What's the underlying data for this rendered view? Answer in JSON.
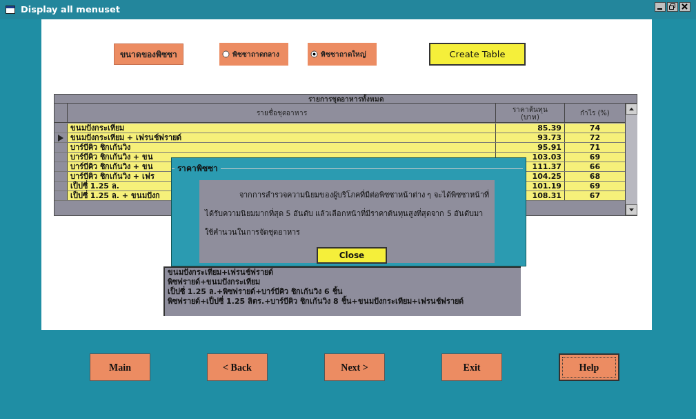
{
  "window": {
    "title": "Display all menuset"
  },
  "size_label": "ขนาดของพิซซา",
  "size_options": [
    {
      "label": "พิซซาถาดกลาง",
      "selected": false
    },
    {
      "label": "พิซซาถาดใหญ่",
      "selected": true
    }
  ],
  "create_button": "Create Table",
  "grid": {
    "title": "รายการชุดอาหารทั้งหมด",
    "columns": [
      "รายชื่อชุดอาหาร",
      "ราคาต้นทุน (บาท)",
      "กำไร (%)"
    ],
    "rows": [
      {
        "name": "ขนมปังกระเทียม",
        "cost": "85.39",
        "profit": "74",
        "current": false
      },
      {
        "name": "ขนมปังกระเทียม + เฟรนช์ฟรายด์",
        "cost": "93.73",
        "profit": "72",
        "current": true
      },
      {
        "name": "บาร์บีคิว ชิกเก้นวิง",
        "cost": "95.91",
        "profit": "71",
        "current": false
      },
      {
        "name": "บาร์บีคิว ชิกเก้นวิง + ขน",
        "cost": "103.03",
        "profit": "69",
        "current": false
      },
      {
        "name": "บาร์บีคิว ชิกเก้นวิง + ขน",
        "cost": "111.37",
        "profit": "66",
        "current": false
      },
      {
        "name": "บาร์บีคิว ชิกเก้นวิง + เฟร",
        "cost": "104.25",
        "profit": "68",
        "current": false
      },
      {
        "name": "เป็ปซี่ 1.25 ล.",
        "cost": "101.19",
        "profit": "69",
        "current": false
      },
      {
        "name": "เป็ปซี่ 1.25 ล. + ขนมปังก",
        "cost": "108.31",
        "profit": "67",
        "current": false
      }
    ]
  },
  "combo_list": [
    "ขนมปังกระเทียม+เฟรนช์ฟรายด์",
    "พิซฟรายด์+ขนมปังกระเทียม",
    "เป็ปซี่ 1.25 ล.+พิซฟรายด์+บาร์บีคิว ชิกเก้นวิง 6 ชิ้น",
    "พิซฟรายด์+เป็ปซี่ 1.25 ลิตร.+บาร์บีคิว ชิกเก้นวิง 8 ชิ้น+ขนมปังกระเทียม+เฟรนช์ฟรายด์"
  ],
  "dialog": {
    "title": "ราคาพิซซา",
    "message": "จากการสำรวจความนิยมของผู้บริโภคที่มีต่อพิซซาหน้าต่าง ๆ จะได้พิซซาหน้าที่ได้รับความนิยมมากที่สุด 5 อันดับ แล้วเลือกหน้าที่มีราคาต้นทุนสูงที่สุดจาก 5 อันดับมาใช้คำนวนในการจัดชุดอาหาร",
    "button": "Close"
  },
  "nav_buttons": [
    {
      "label": "Main",
      "focused": false
    },
    {
      "label": "< Back",
      "focused": false
    },
    {
      "label": "Next >",
      "focused": false
    },
    {
      "label": "Exit",
      "focused": false
    },
    {
      "label": "Help",
      "focused": true
    }
  ]
}
